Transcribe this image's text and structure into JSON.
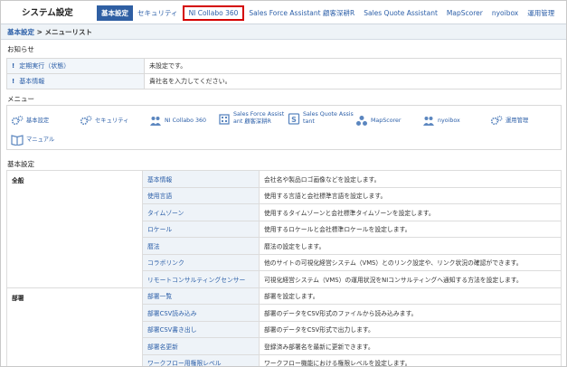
{
  "app": {
    "title": "システム設定"
  },
  "tabs": [
    {
      "label": "基本設定",
      "state": "active"
    },
    {
      "label": "セキュリティ",
      "state": ""
    },
    {
      "label": "NI Collabo 360",
      "state": "highlight"
    },
    {
      "label": "Sales Force Assistant 顧客深耕R",
      "state": ""
    },
    {
      "label": "Sales Quote Assistant",
      "state": ""
    },
    {
      "label": "MapScorer",
      "state": ""
    },
    {
      "label": "nyoibox",
      "state": ""
    },
    {
      "label": "運用管理",
      "state": ""
    }
  ],
  "breadcrumb": {
    "link": "基本設定",
    "separator": " > ",
    "current": "メニューリスト"
  },
  "notices": {
    "heading": "お知らせ",
    "rows": [
      {
        "mark": "!",
        "label": "定期実行（状態）",
        "value": "未設定です。"
      },
      {
        "mark": "!",
        "label": "基本情報",
        "value": "貴社名を入力してください。"
      }
    ]
  },
  "menu": {
    "heading": "メニュー",
    "items": [
      {
        "icon": "gears-icon",
        "label": "基本設定"
      },
      {
        "icon": "gears-icon",
        "label": "セキュリティ"
      },
      {
        "icon": "people-icon",
        "label": "NI Collabo 360"
      },
      {
        "icon": "building-icon",
        "label": "Sales Force Assistant 顧客深耕R",
        "line1": "Sales Force Assist",
        "line2": "ant 顧客深耕R"
      },
      {
        "icon": "s-box-icon",
        "label": "Sales Quote Assistant",
        "line1": "Sales Quote Assis",
        "line2": "tant"
      },
      {
        "icon": "circles-icon",
        "label": "MapScorer"
      },
      {
        "icon": "people-icon",
        "label": "nyoibox"
      },
      {
        "icon": "gears-icon",
        "label": "運用管理"
      },
      {
        "icon": "book-icon",
        "label": "マニュアル"
      }
    ]
  },
  "settings": {
    "heading": "基本設定",
    "groups": [
      {
        "name": "全般",
        "rows": [
          {
            "name": "基本情報",
            "desc": "会社名や製品ロゴ画像などを設定します。"
          },
          {
            "name": "使用言語",
            "desc": "使用する言語と会社標準言語を設定します。"
          },
          {
            "name": "タイムゾーン",
            "desc": "使用するタイムゾーンと会社標準タイムゾーンを設定します。"
          },
          {
            "name": "ロケール",
            "desc": "使用するロケールと会社標準ロケールを設定します。"
          },
          {
            "name": "暦法",
            "desc": "暦法の設定をします。"
          },
          {
            "name": "コラボリンク",
            "desc": "他のサイトの可視化経営システム（VMS）とのリンク設定や、リンク状況の確認ができます。"
          },
          {
            "name": "リモートコンサルティングセンサー",
            "desc": "可視化経営システム（VMS）の運用状況をNIコンサルティングへ通知する方法を設定します。"
          }
        ]
      },
      {
        "name": "部署",
        "rows": [
          {
            "name": "部署一覧",
            "desc": "部署を設定します。"
          },
          {
            "name": "部署CSV読み込み",
            "desc": "部署のデータをCSV形式のファイルから読み込みます。"
          },
          {
            "name": "部署CSV書き出し",
            "desc": "部署のデータをCSV形式で出力します。"
          },
          {
            "name": "部署名更新",
            "desc": "登録済み部署名を最新に更新できます。"
          },
          {
            "name": "ワークフロー用権限レベル",
            "desc": "ワークフロー機能における権限レベルを設定します。"
          }
        ]
      }
    ]
  }
}
